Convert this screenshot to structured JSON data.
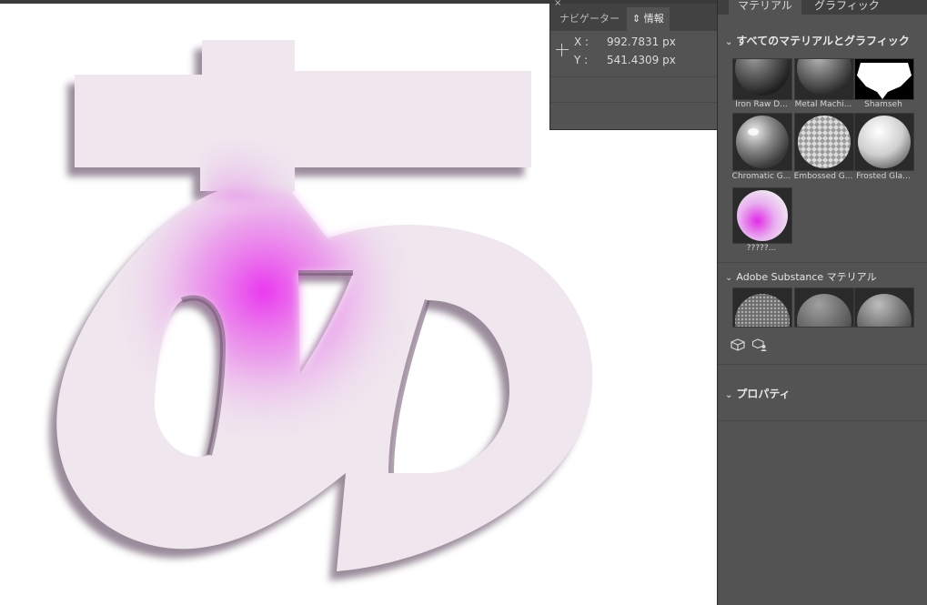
{
  "info_panel": {
    "tabs": [
      {
        "label": "ナビゲーター"
      },
      {
        "label": "⇕ 情報"
      }
    ],
    "x_label": "X :",
    "x_value": "992.7831 px",
    "y_label": "Y :",
    "y_value": "541.4309 px"
  },
  "right_panel": {
    "tabs": [
      {
        "label": "マテリアル"
      },
      {
        "label": "グラフィック"
      }
    ],
    "section_all": "すべてのマテリアルとグラフィック",
    "materials": [
      {
        "label": "Iron Raw D..."
      },
      {
        "label": "Metal Machi..."
      },
      {
        "label": "Shamseh"
      },
      {
        "label": "Chromatic G..."
      },
      {
        "label": "Embossed G..."
      },
      {
        "label": "Frosted Gla..."
      },
      {
        "label": "?​?​?​?​?​..."
      }
    ],
    "section_substance": "Adobe Substance マテリアル",
    "section_properties": "プロパティ"
  },
  "colors": {
    "panel_bg": "#535353",
    "panel_dark": "#424242",
    "glyph_base": "#efe6ee",
    "glyph_glow": "#ea2cef"
  },
  "icons": [
    "crosshair-icon",
    "chevron-down-icon",
    "cube-icon",
    "cube-user-icon"
  ]
}
